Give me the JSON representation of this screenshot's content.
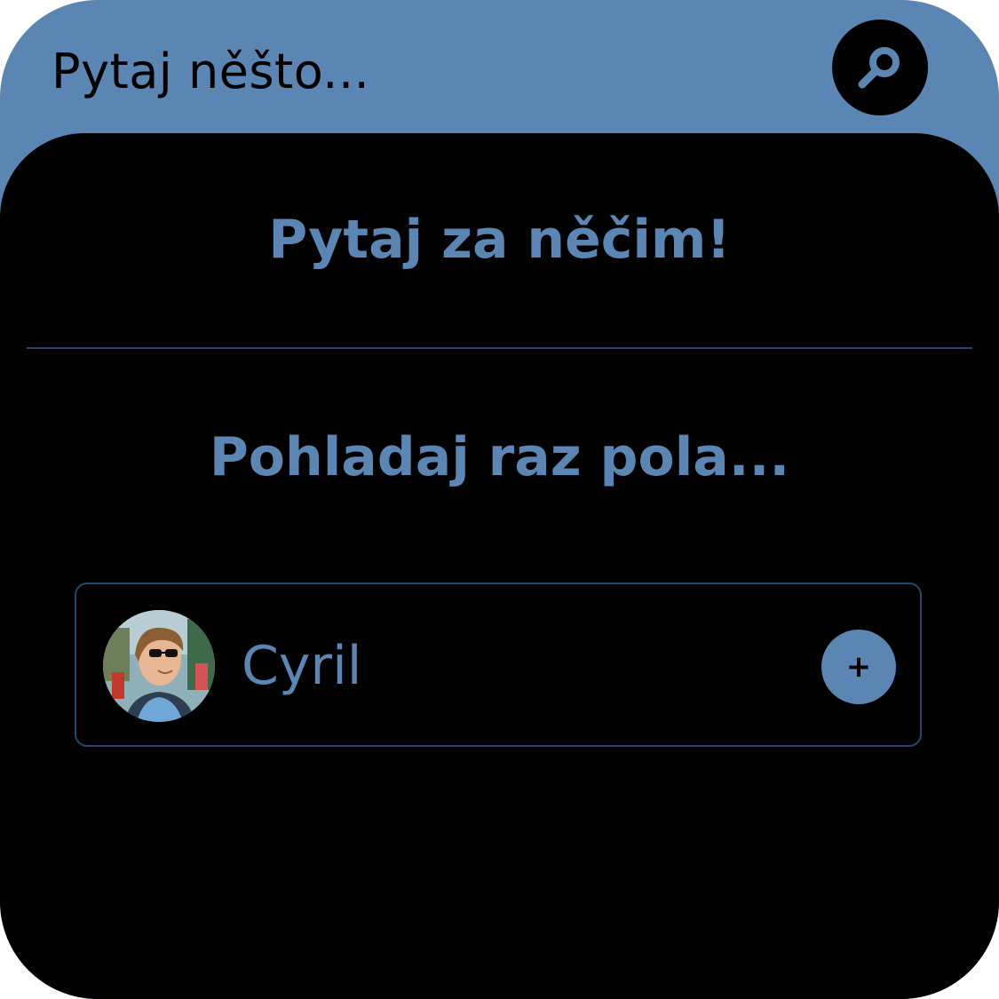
{
  "search": {
    "placeholder": "Pytaj něšto...",
    "button_icon": "search-icon"
  },
  "panel": {
    "title": "Pytaj za něčim!",
    "subtitle": "Pohladaj raz pola..."
  },
  "users": [
    {
      "name": "Cyril",
      "avatar": "avatar-photo",
      "action_label": "+",
      "action_icon": "plus-icon"
    }
  ],
  "colors": {
    "accent": "#5b86b3",
    "background": "#000000",
    "border": "#24466e"
  }
}
